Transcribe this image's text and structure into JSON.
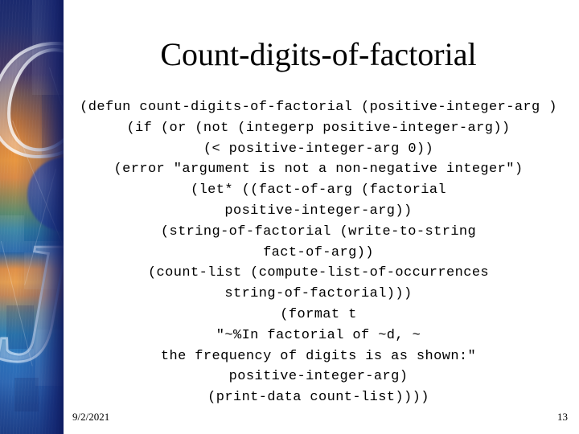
{
  "slide": {
    "title": "Count-digits-of-factorial",
    "code_lines": [
      "(defun count-digits-of-factorial (positive-integer-arg )",
      "(if (or (not (integerp positive-integer-arg))",
      "(< positive-integer-arg 0))",
      "(error \"argument is not a non-negative integer\")",
      "(let* ((fact-of-arg (factorial",
      "positive-integer-arg))",
      "(string-of-factorial (write-to-string",
      "fact-of-arg))",
      "(count-list (compute-list-of-occurrences",
      "string-of-factorial)))",
      "(format t",
      "\"~%In factorial of ~d, ~",
      "the frequency of digits is as shown:\"",
      "positive-integer-arg)",
      "(print-data count-list))))"
    ],
    "footer": {
      "date": "9/2/2021",
      "page_number": "13"
    },
    "decoration": {
      "glyph_top": "O",
      "glyph_bottom": "J",
      "colors": {
        "navy": "#1b2a6e",
        "purple": "#4b3a63",
        "orange": "#e08a3c",
        "teal": "#2f82b8",
        "blue": "#2a74bd",
        "text": "#000000",
        "background": "#ffffff"
      }
    }
  }
}
